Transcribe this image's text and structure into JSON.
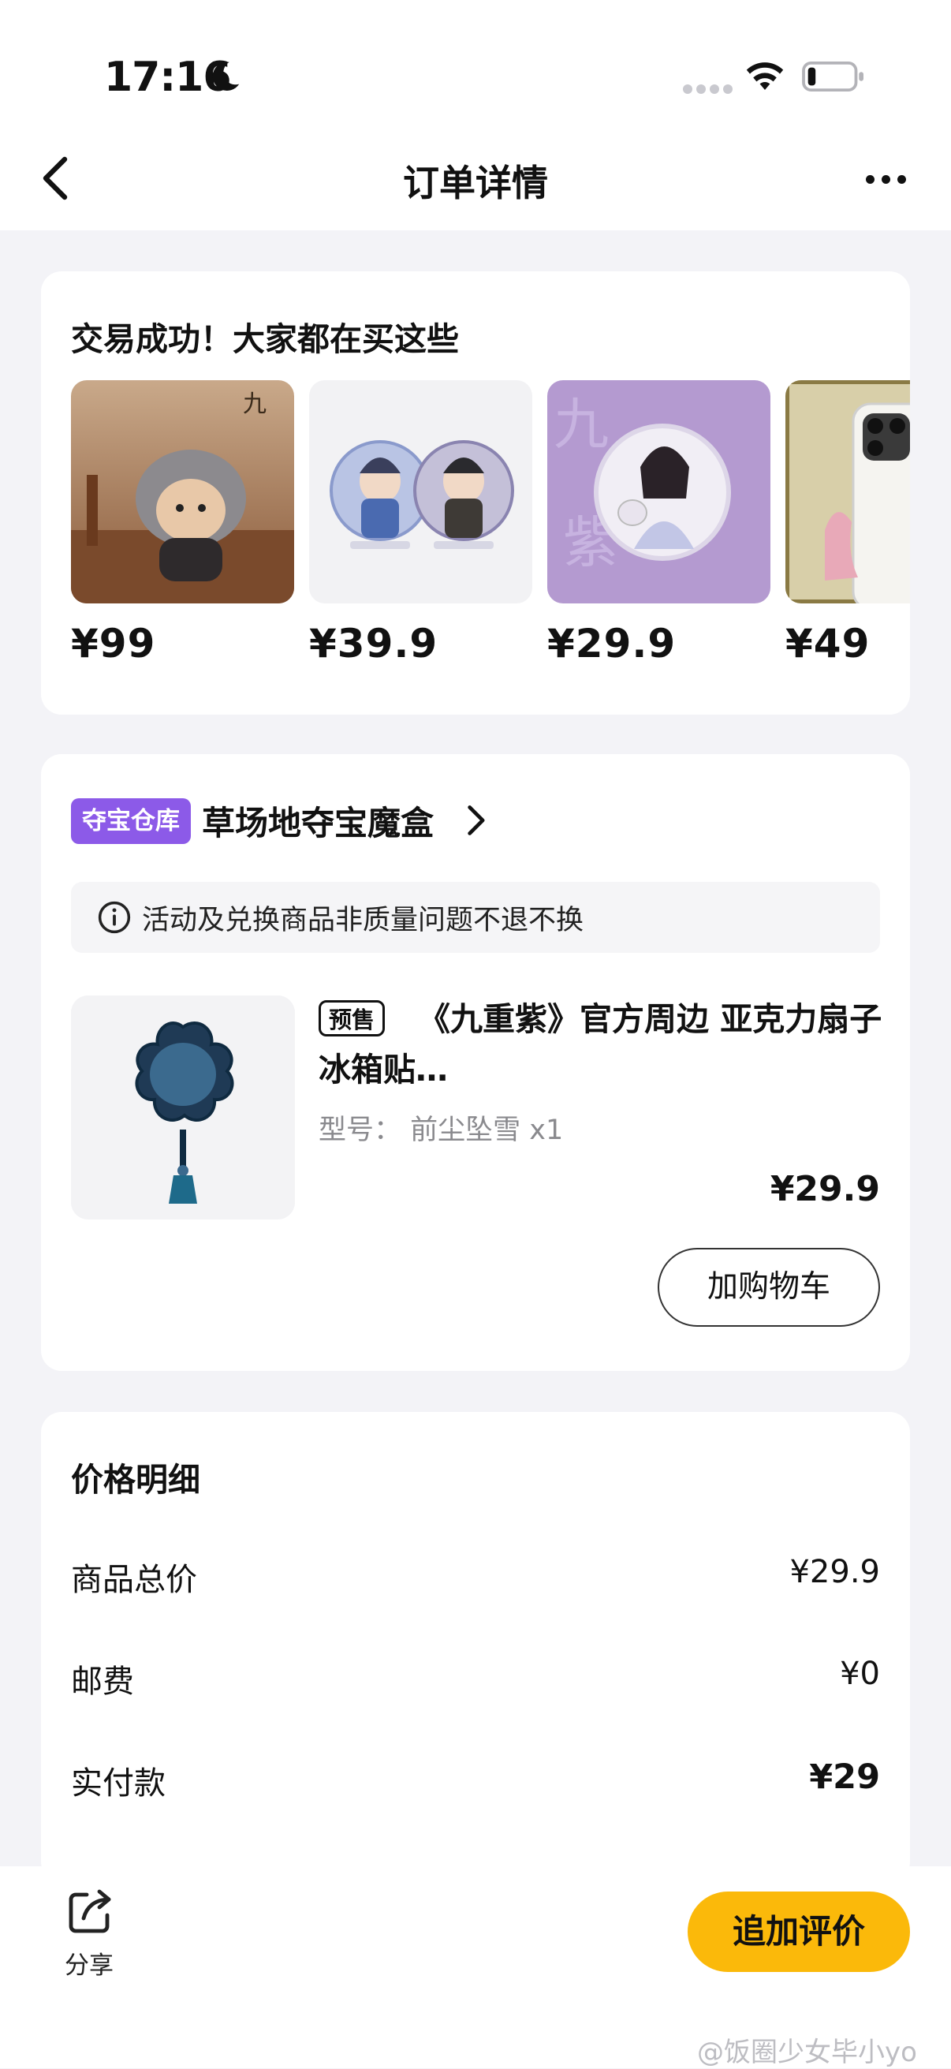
{
  "status_bar": {
    "time": "17:16"
  },
  "nav": {
    "title": "订单详情"
  },
  "recommend": {
    "title": "交易成功！大家都在买这些",
    "items": [
      {
        "price": "¥99"
      },
      {
        "price": "¥39.9"
      },
      {
        "price": "¥29.9"
      },
      {
        "price": "¥49"
      }
    ]
  },
  "store": {
    "tag": "夺宝仓库",
    "name": "草场地夺宝魔盒",
    "notice": "活动及兑换商品非质量问题不退不换",
    "product": {
      "badge": "预售",
      "title": "《九重紫》官方周边 亚克力扇子冰箱贴…",
      "spec": "型号：  前尘坠雪 x1",
      "price": "¥29.9",
      "cart_button": "加购物车"
    }
  },
  "price_detail": {
    "title": "价格明细",
    "rows": [
      {
        "label": "商品总价",
        "value": "¥29.9"
      },
      {
        "label": "邮费",
        "value": "¥0"
      },
      {
        "label": "实付款",
        "value": "¥29"
      }
    ]
  },
  "bottom": {
    "share_label": "分享",
    "review_button": "追加评价",
    "watermark": "@饭圈少女毕小yo"
  },
  "colors": {
    "accent": "#fbb90a",
    "tag": "#8c5ae8",
    "background": "#f3f3f7"
  }
}
